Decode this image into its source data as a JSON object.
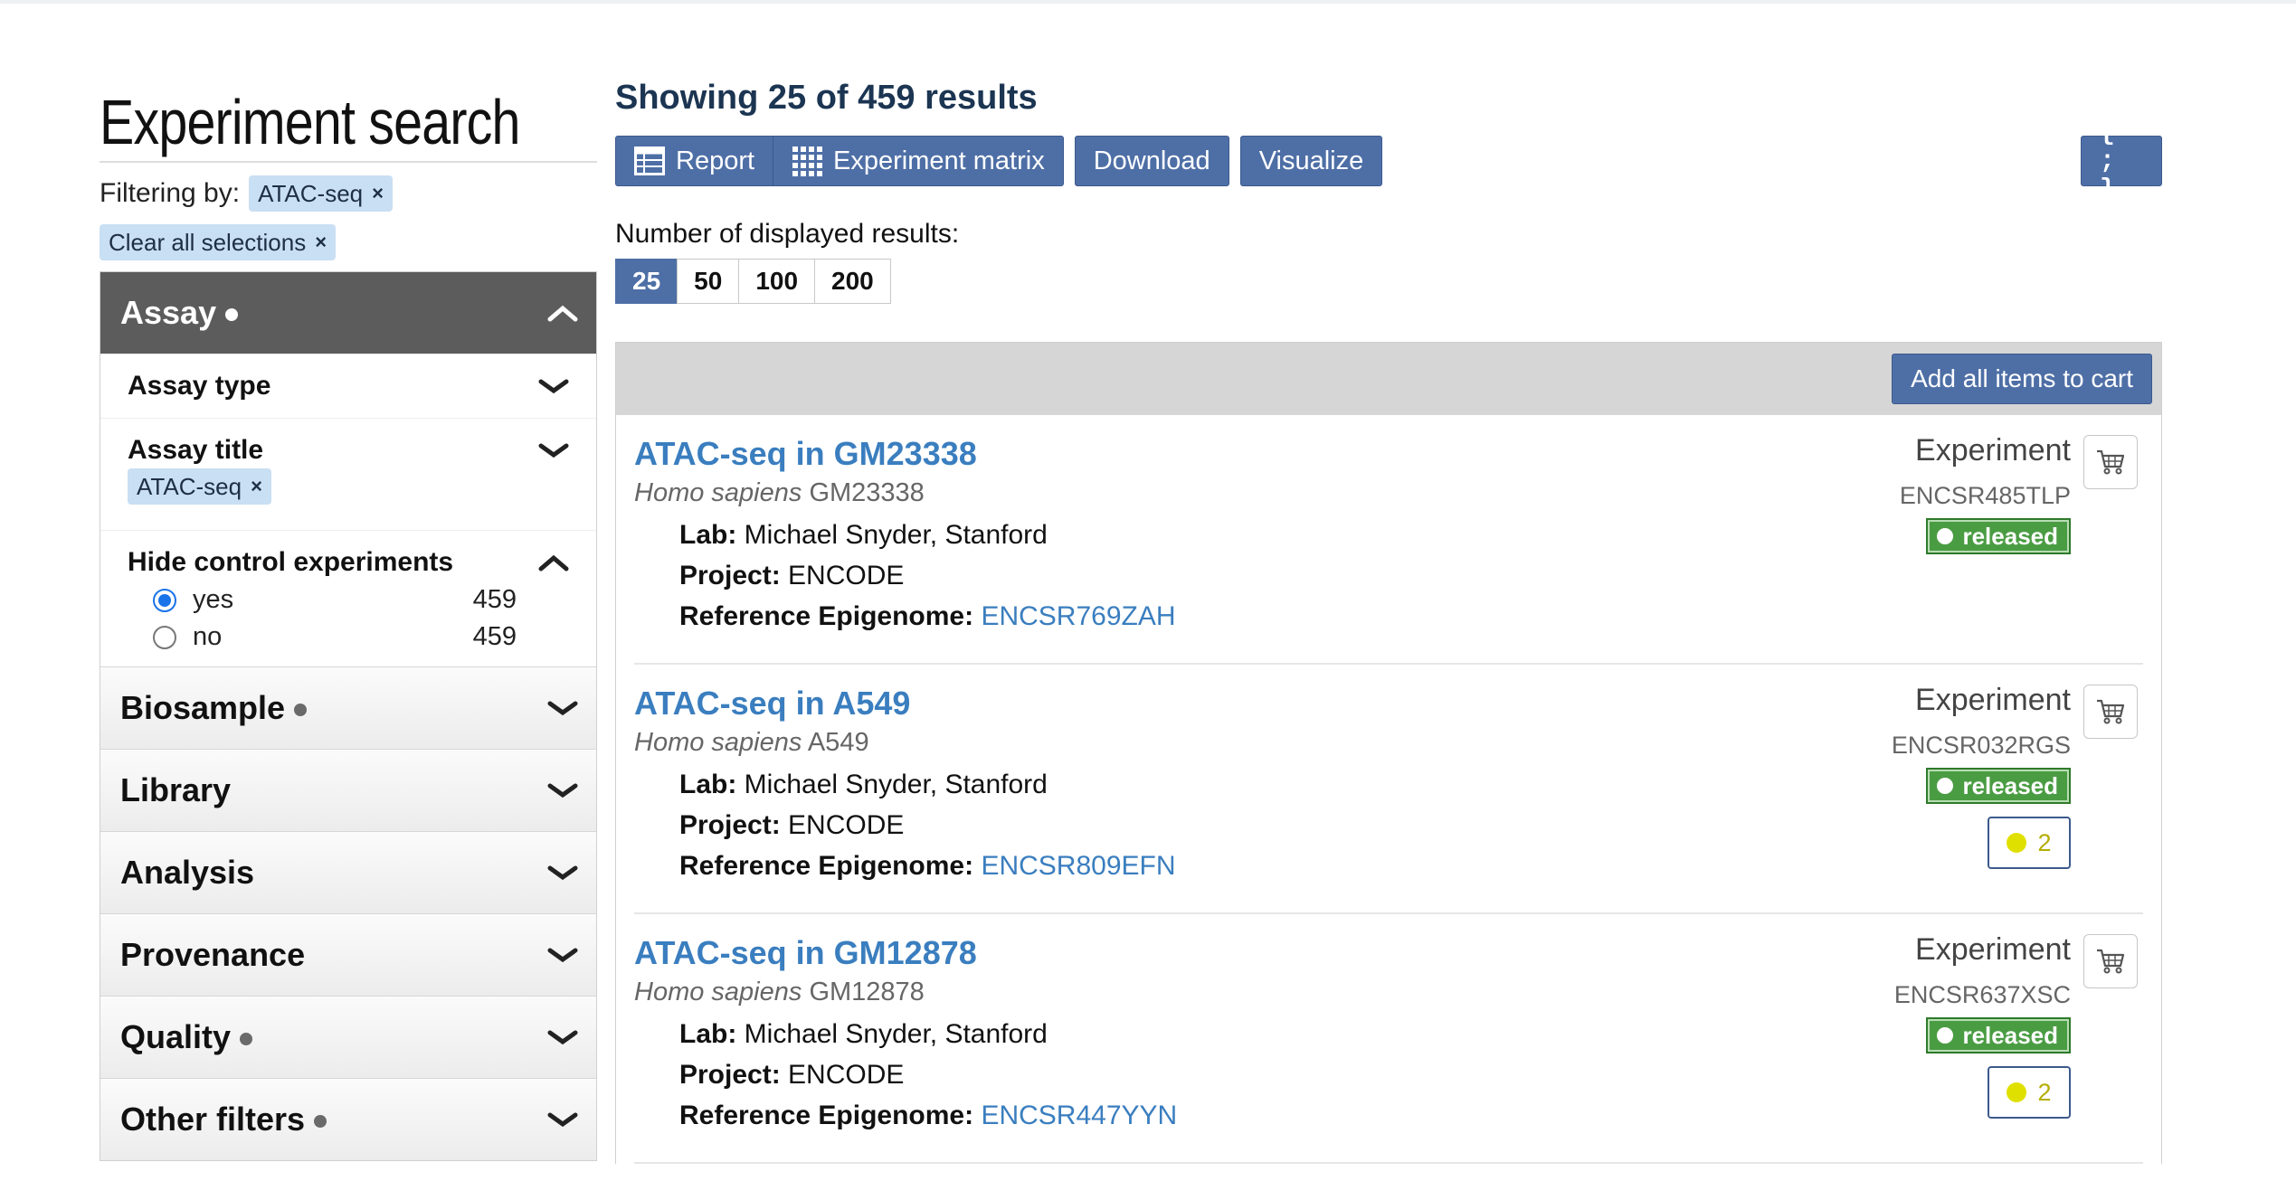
{
  "page": {
    "title": "Experiment search",
    "filtering_label": "Filtering by:",
    "filter_pill": "ATAC-seq",
    "clear_all": "Clear all selections",
    "remove_glyph": "×"
  },
  "facets": {
    "assay": {
      "label": "Assay"
    },
    "assay_type": {
      "label": "Assay type"
    },
    "assay_title": {
      "label": "Assay title",
      "selected": "ATAC-seq"
    },
    "hide_control": {
      "label": "Hide control experiments",
      "options": [
        {
          "label": "yes",
          "count": "459",
          "checked": true
        },
        {
          "label": "no",
          "count": "459",
          "checked": false
        }
      ]
    },
    "groups": [
      {
        "label": "Biosample",
        "dot": true
      },
      {
        "label": "Library",
        "dot": false
      },
      {
        "label": "Analysis",
        "dot": false
      },
      {
        "label": "Provenance",
        "dot": false
      },
      {
        "label": "Quality",
        "dot": true
      },
      {
        "label": "Other filters",
        "dot": true
      }
    ]
  },
  "results_header": {
    "showing": "Showing 25 of 459 results",
    "buttons": {
      "report": "Report",
      "matrix": "Experiment matrix",
      "download": "Download",
      "visualize": "Visualize",
      "json": "{ ; }"
    },
    "num_label": "Number of displayed results:",
    "page_sizes": [
      "25",
      "50",
      "100",
      "200"
    ],
    "active_page_size": "25",
    "add_all": "Add all items to cart"
  },
  "results": [
    {
      "title": "ATAC-seq in GM23338",
      "organism": "Homo sapiens",
      "biosample": "GM23338",
      "type": "Experiment",
      "accession": "ENCSR485TLP",
      "status": "released",
      "lab_label": "Lab:",
      "lab": "Michael Snyder, Stanford",
      "project_label": "Project:",
      "project": "ENCODE",
      "ref_label": "Reference Epigenome:",
      "ref": "ENCSR769ZAH",
      "audit": ""
    },
    {
      "title": "ATAC-seq in A549",
      "organism": "Homo sapiens",
      "biosample": "A549",
      "type": "Experiment",
      "accession": "ENCSR032RGS",
      "status": "released",
      "lab_label": "Lab:",
      "lab": "Michael Snyder, Stanford",
      "project_label": "Project:",
      "project": "ENCODE",
      "ref_label": "Reference Epigenome:",
      "ref": "ENCSR809EFN",
      "audit": "2"
    },
    {
      "title": "ATAC-seq in GM12878",
      "organism": "Homo sapiens",
      "biosample": "GM12878",
      "type": "Experiment",
      "accession": "ENCSR637XSC",
      "status": "released",
      "lab_label": "Lab:",
      "lab": "Michael Snyder, Stanford",
      "project_label": "Project:",
      "project": "ENCODE",
      "ref_label": "Reference Epigenome:",
      "ref": "ENCSR447YYN",
      "audit": "2"
    }
  ],
  "icons": {
    "cart": "shopping-cart-icon",
    "report": "table-icon",
    "matrix": "grid-icon",
    "chevron_up": "chevron-up-icon",
    "chevron_down": "chevron-down-icon"
  },
  "colors": {
    "primary_button": "#4e6fa6",
    "link": "#3a7ebf",
    "released": "#4a9c43",
    "audit_dot": "#e0e000",
    "pill": "#c9dff3",
    "facet_dark": "#5c5c5c"
  }
}
